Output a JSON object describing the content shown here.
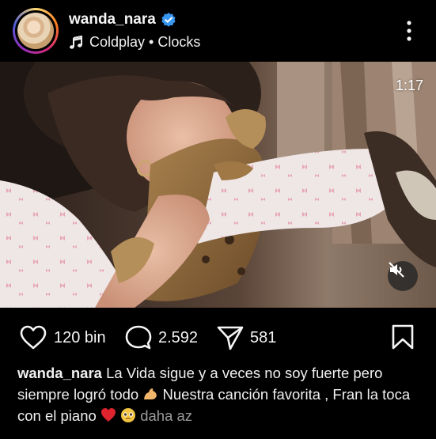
{
  "post": {
    "username": "wanda_nara",
    "music": "Coldplay • Clocks",
    "video_time": "1:17",
    "likes": "120 bin",
    "comments": "2.592",
    "shares": "581",
    "caption_part1": "La Vida sigue y a veces no soy fuerte pero siempre logró todo",
    "caption_part2": "Nuestra canción favorita , Fran la toca con el piano",
    "more_label": "daha az"
  },
  "icons": {
    "verified": "verified-badge-icon",
    "music": "music-note-icon",
    "more": "more-options-icon",
    "mute": "muted-speaker-icon",
    "like": "heart-icon",
    "comment": "comment-icon",
    "share": "send-icon",
    "save": "bookmark-icon"
  },
  "colors": {
    "background": "#000000",
    "verified": "#3897f0",
    "text": "#f5f5f5",
    "muted_text": "#9a9a9a"
  }
}
